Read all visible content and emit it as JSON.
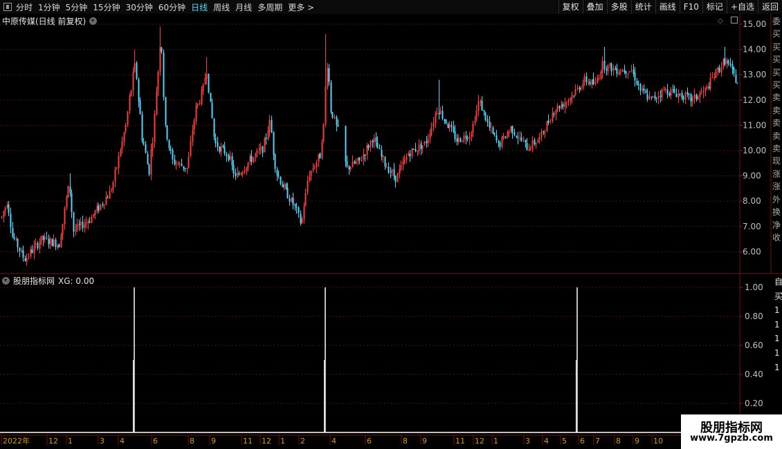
{
  "toolbar": {
    "periods": [
      "分时",
      "1分钟",
      "5分钟",
      "15分钟",
      "30分钟",
      "60分钟",
      "日线",
      "周线",
      "月线",
      "多周期",
      "更多 >"
    ],
    "active_period": "日线",
    "right_buttons": [
      "复权",
      "叠加",
      "多股",
      "统计",
      "画线",
      "F10",
      "标记",
      "+自选",
      "返回"
    ]
  },
  "main_chart": {
    "title": "中原传媒(日线 前复权)",
    "price_axis": [
      "15.00",
      "14.00",
      "13.00",
      "12.00",
      "11.00",
      "10.00",
      "9.00",
      "8.00",
      "7.00",
      "6.00"
    ],
    "up_color": "#ff3c3c",
    "down_color": "#4fd9ff"
  },
  "indicator": {
    "name": "股朋指标网",
    "value_label": "XG: 0.00",
    "axis": [
      "1.00",
      "0.80",
      "0.60",
      "0.40",
      "0.20"
    ],
    "signal_color": "#ffffff"
  },
  "time_axis": {
    "labels": [
      "2022年",
      "12",
      "1",
      "3",
      "4",
      "6",
      "8",
      "9",
      "11",
      "12",
      "1",
      "2",
      "4",
      "6",
      "8",
      "9",
      "11",
      "12",
      "1",
      "3",
      "4",
      "5",
      "6",
      "7",
      "8",
      "9",
      "10"
    ]
  },
  "side_panel": {
    "top_chars": "委买买买买买卖卖卖卖卖现涨涨外换净收",
    "bottom_chars": "自买11111"
  },
  "watermark": {
    "title": "股朋指标网",
    "url": "www.7gpzb.com"
  }
}
